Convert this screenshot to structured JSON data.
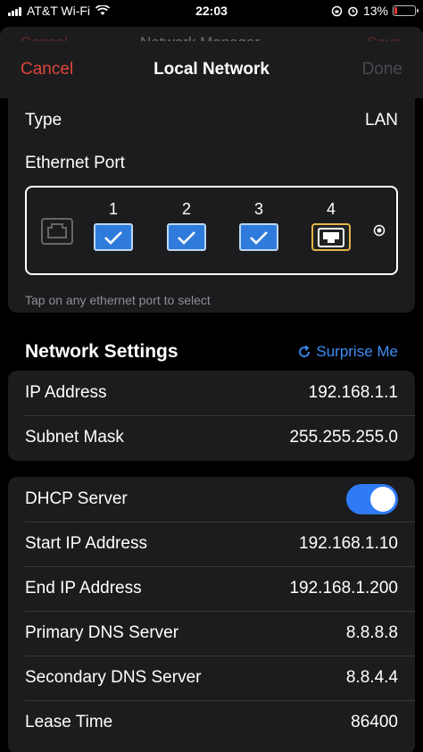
{
  "status_bar": {
    "carrier": "AT&T Wi-Fi",
    "time": "22:03",
    "battery": "13%",
    "battery_fraction": 0.13
  },
  "background_sheet": {
    "left": "Cancel",
    "title": "Network Manager",
    "right": "Save"
  },
  "nav": {
    "cancel": "Cancel",
    "title": "Local Network",
    "done": "Done"
  },
  "general": {
    "type_label": "Type",
    "type_value": "LAN",
    "ethernet_label": "Ethernet Port",
    "ports": [
      {
        "label": "1",
        "state": "checked"
      },
      {
        "label": "2",
        "state": "checked"
      },
      {
        "label": "3",
        "state": "checked"
      },
      {
        "label": "4",
        "state": "selected"
      }
    ],
    "hint": "Tap on any ethernet port to select"
  },
  "network_settings": {
    "header": "Network Settings",
    "surprise": "Surprise Me",
    "ip_label": "IP Address",
    "ip_value": "192.168.1.1",
    "mask_label": "Subnet Mask",
    "mask_value": "255.255.255.0"
  },
  "dhcp": {
    "server_label": "DHCP Server",
    "server_enabled": true,
    "start_label": "Start IP Address",
    "start_value": "192.168.1.10",
    "end_label": "End IP Address",
    "end_value": "192.168.1.200",
    "dns1_label": "Primary DNS Server",
    "dns1_value": "8.8.8.8",
    "dns2_label": "Secondary DNS Server",
    "dns2_value": "8.8.4.4",
    "lease_label": "Lease Time",
    "lease_value": "86400"
  },
  "colors": {
    "accent_blue": "#2f7bf5",
    "cancel_red": "#e0453a",
    "selected_gold": "#e6b545"
  }
}
